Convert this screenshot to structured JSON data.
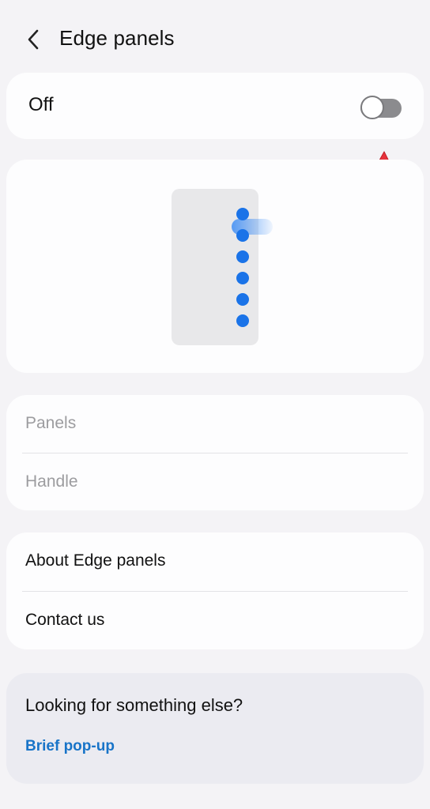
{
  "header": {
    "title": "Edge panels",
    "back_icon": "chevron-left-icon"
  },
  "master_toggle": {
    "label": "Off",
    "state": false,
    "track_color": "#8b8b8e"
  },
  "preview": {
    "dot_color": "#1a73e8",
    "dot_count": 6,
    "annotation_arrow_color": "#e8333d"
  },
  "settings_group_1": {
    "items": [
      {
        "label": "Panels",
        "enabled": false
      },
      {
        "label": "Handle",
        "enabled": false
      }
    ]
  },
  "settings_group_2": {
    "items": [
      {
        "label": "About Edge panels"
      },
      {
        "label": "Contact us"
      }
    ]
  },
  "suggestions": {
    "title": "Looking for something else?",
    "link": "Brief pop-up",
    "link_color": "#1874c8"
  }
}
